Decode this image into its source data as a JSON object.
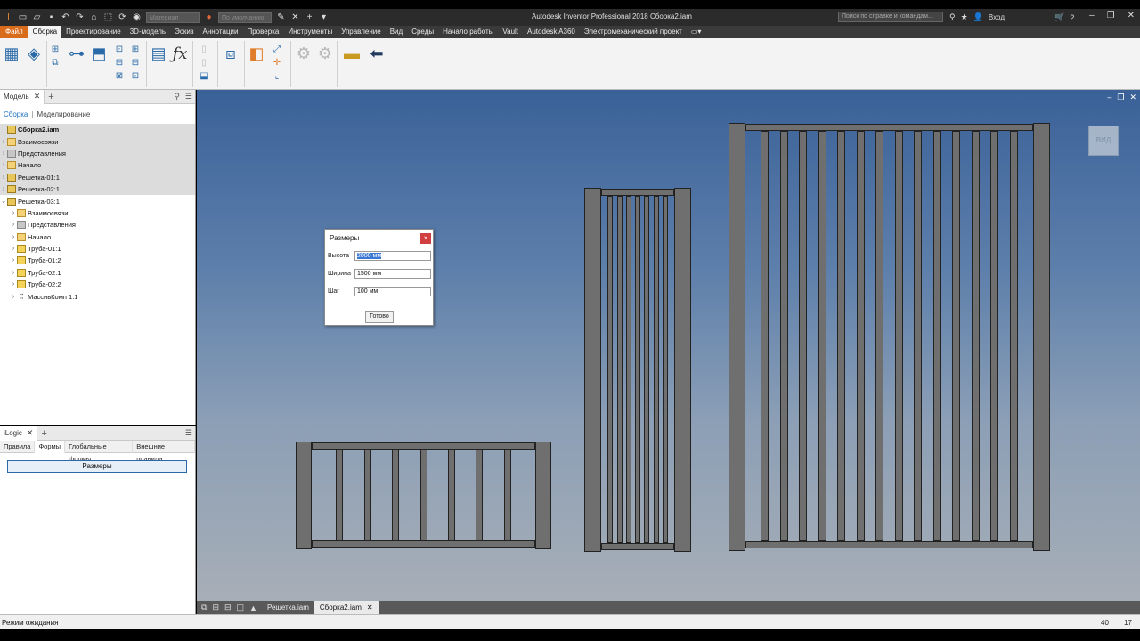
{
  "app": {
    "title": "Autodesk Inventor Professional 2018   Сборка2.iam",
    "search_placeholder": "Поиск по справке и командам...",
    "signin": "Вход",
    "material_dd": "Материал",
    "appearance_dd": "По умолчанию"
  },
  "menu": {
    "tabs": [
      "Файл",
      "Сборка",
      "Проектирование",
      "3D-модель",
      "Эскиз",
      "Аннотации",
      "Проверка",
      "Инструменты",
      "Управление",
      "Вид",
      "Среды",
      "Начало работы",
      "Vault",
      "Autodesk A360",
      "Электромеханический проект"
    ],
    "active": "Сборка"
  },
  "browser": {
    "tab_label": "Модель",
    "crumb_link": "Сборка",
    "crumb_sep": "|",
    "crumb_mode": "Моделирование",
    "tree": [
      {
        "label": "Сборка2.iam",
        "level": 0,
        "icon": "assembly-icon",
        "bold": true,
        "sel": true,
        "arrow": ""
      },
      {
        "label": "Взаимосвязи",
        "level": 0,
        "icon": "folder-icon",
        "sel": true,
        "arrow": "›"
      },
      {
        "label": "Представления",
        "level": 0,
        "icon": "views-icon",
        "sel": true,
        "arrow": "›"
      },
      {
        "label": "Начало",
        "level": 0,
        "icon": "folder-icon",
        "sel": true,
        "arrow": "›"
      },
      {
        "label": "Решетка-01:1",
        "level": 0,
        "icon": "assembly-icon",
        "sel": true,
        "arrow": "›"
      },
      {
        "label": "Решетка-02:1",
        "level": 0,
        "icon": "assembly-icon",
        "sel": true,
        "arrow": "›"
      },
      {
        "label": "Решетка-03:1",
        "level": 0,
        "icon": "assembly-icon",
        "sel": false,
        "arrow": "⌄"
      },
      {
        "label": "Взаимосвязи",
        "level": 1,
        "icon": "folder-icon",
        "sel": false,
        "arrow": "›"
      },
      {
        "label": "Представления",
        "level": 1,
        "icon": "views-icon",
        "sel": false,
        "arrow": "›"
      },
      {
        "label": "Начало",
        "level": 1,
        "icon": "folder-icon",
        "sel": false,
        "arrow": "›"
      },
      {
        "label": "Труба-01:1",
        "level": 1,
        "icon": "part-icon",
        "sel": false,
        "arrow": "›"
      },
      {
        "label": "Труба-01:2",
        "level": 1,
        "icon": "part-icon",
        "sel": false,
        "arrow": "›"
      },
      {
        "label": "Труба-02:1",
        "level": 1,
        "icon": "part-icon",
        "sel": false,
        "arrow": "›"
      },
      {
        "label": "Труба-02:2",
        "level": 1,
        "icon": "part-icon",
        "sel": false,
        "arrow": "›"
      },
      {
        "label": "МассивКомп 1:1",
        "level": 1,
        "icon": "pattern-icon",
        "sel": false,
        "arrow": "›"
      }
    ]
  },
  "ilogic": {
    "tab_label": "iLogic",
    "subtabs": [
      "Правила",
      "Формы",
      "Глобальные формы",
      "Внешние правила"
    ],
    "active_subtab": "Формы",
    "form_button": "Размеры"
  },
  "dialog": {
    "title": "Размеры",
    "close": "×",
    "fields": [
      {
        "label": "Высота",
        "value": "2000 мм",
        "selected": true
      },
      {
        "label": "Ширина",
        "value": "1500 мм",
        "selected": false
      },
      {
        "label": "Шаг",
        "value": "100 мм",
        "selected": false
      }
    ],
    "ok": "Готово"
  },
  "viewcube_label": "ВИД",
  "doctabs": {
    "tabs": [
      "Решетка.iam",
      "Сборка2.iam"
    ],
    "active": "Сборка2.iam"
  },
  "status": {
    "text": "Режим ожидания",
    "n1": "40",
    "n2": "17"
  },
  "colors": {
    "file_tab": "#d96c1a",
    "viewport_top": "#3a6198",
    "viewport_bottom": "#a7aeb7",
    "part_fill": "#6f6f6f"
  }
}
